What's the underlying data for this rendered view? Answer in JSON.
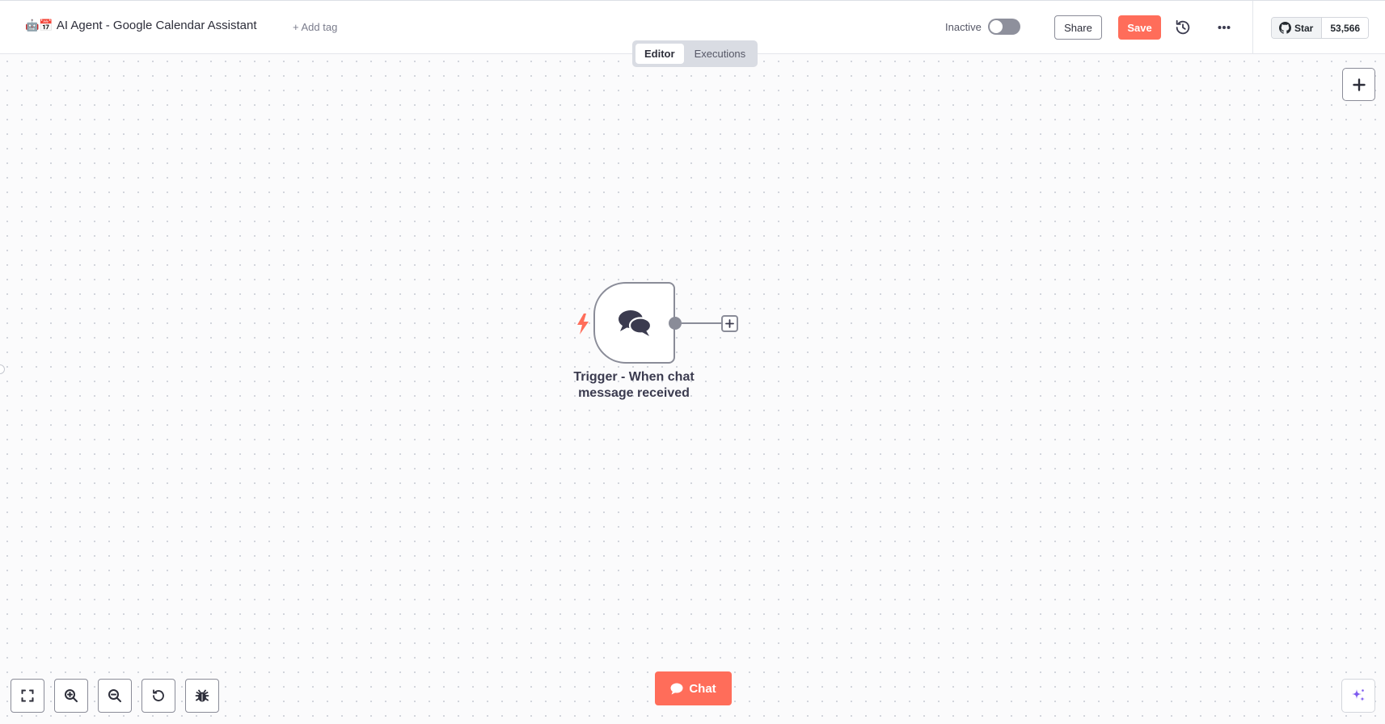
{
  "header": {
    "workflow_emoji": "🤖📅",
    "workflow_title": "AI Agent - Google Calendar Assistant",
    "add_tag_label": "+ Add tag",
    "status_label": "Inactive",
    "active": false,
    "share_label": "Share",
    "save_label": "Save",
    "github": {
      "star_label": "Star",
      "star_count": "53,566"
    }
  },
  "mode_tabs": [
    {
      "label": "Editor",
      "active": true
    },
    {
      "label": "Executions",
      "active": false
    }
  ],
  "canvas": {
    "nodes": [
      {
        "label": "Trigger - When chat message received",
        "icon": "chat-bubbles-icon",
        "trigger": true
      }
    ]
  },
  "footer": {
    "chat_label": "Chat"
  },
  "colors": {
    "accent": "#ff6d5a",
    "node_border": "#8a8c98",
    "ai_sparkle": "#7e5bef"
  }
}
